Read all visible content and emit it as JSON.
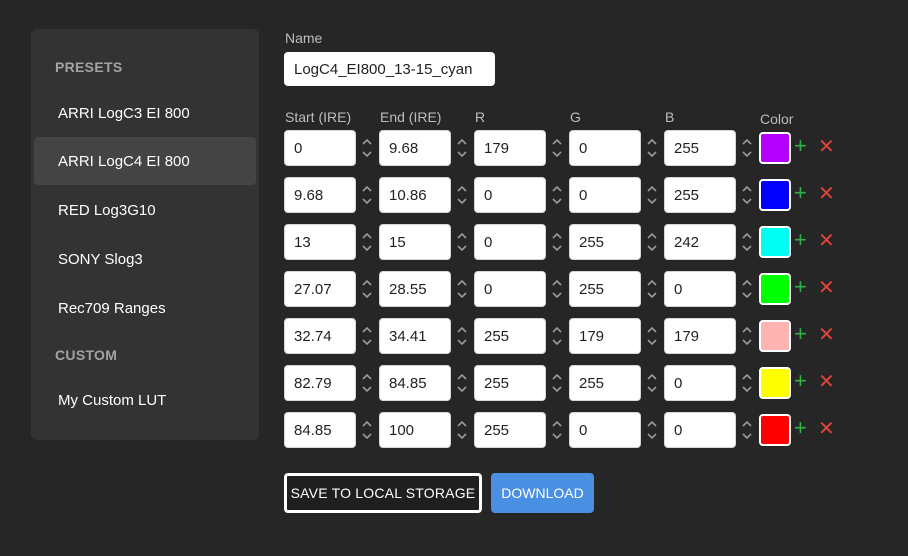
{
  "sidebar": {
    "presets_header": "PRESETS",
    "presets": [
      {
        "label": "ARRI LogC3 EI 800",
        "active": false
      },
      {
        "label": "ARRI LogC4 EI 800",
        "active": true
      },
      {
        "label": "RED Log3G10",
        "active": false
      },
      {
        "label": "SONY Slog3",
        "active": false
      },
      {
        "label": "Rec709 Ranges",
        "active": false
      }
    ],
    "custom_header": "CUSTOM",
    "custom": [
      {
        "label": "My Custom LUT"
      }
    ]
  },
  "editor": {
    "name_label": "Name",
    "name_value": "LogC4_EI800_13-15_cyan",
    "columns": {
      "start": "Start (IRE)",
      "end": "End (IRE)",
      "r": "R",
      "g": "G",
      "b": "B",
      "color": "Color"
    },
    "rows": [
      {
        "start": "0",
        "end": "9.68",
        "r": "179",
        "g": "0",
        "b": "255",
        "color": "#b300ff"
      },
      {
        "start": "9.68",
        "end": "10.86",
        "r": "0",
        "g": "0",
        "b": "255",
        "color": "#0000ff"
      },
      {
        "start": "13",
        "end": "15",
        "r": "0",
        "g": "255",
        "b": "242",
        "color": "#00fff2"
      },
      {
        "start": "27.07",
        "end": "28.55",
        "r": "0",
        "g": "255",
        "b": "0",
        "color": "#00ff00"
      },
      {
        "start": "32.74",
        "end": "34.41",
        "r": "255",
        "g": "179",
        "b": "179",
        "color": "#ffb3b3"
      },
      {
        "start": "82.79",
        "end": "84.85",
        "r": "255",
        "g": "255",
        "b": "0",
        "color": "#ffff00"
      },
      {
        "start": "84.85",
        "end": "100",
        "r": "255",
        "g": "0",
        "b": "0",
        "color": "#ff0000"
      }
    ],
    "add_icon": "plus-icon",
    "remove_icon": "close-icon"
  },
  "actions": {
    "save_label": "SAVE TO LOCAL STORAGE",
    "download_label": "DOWNLOAD"
  }
}
